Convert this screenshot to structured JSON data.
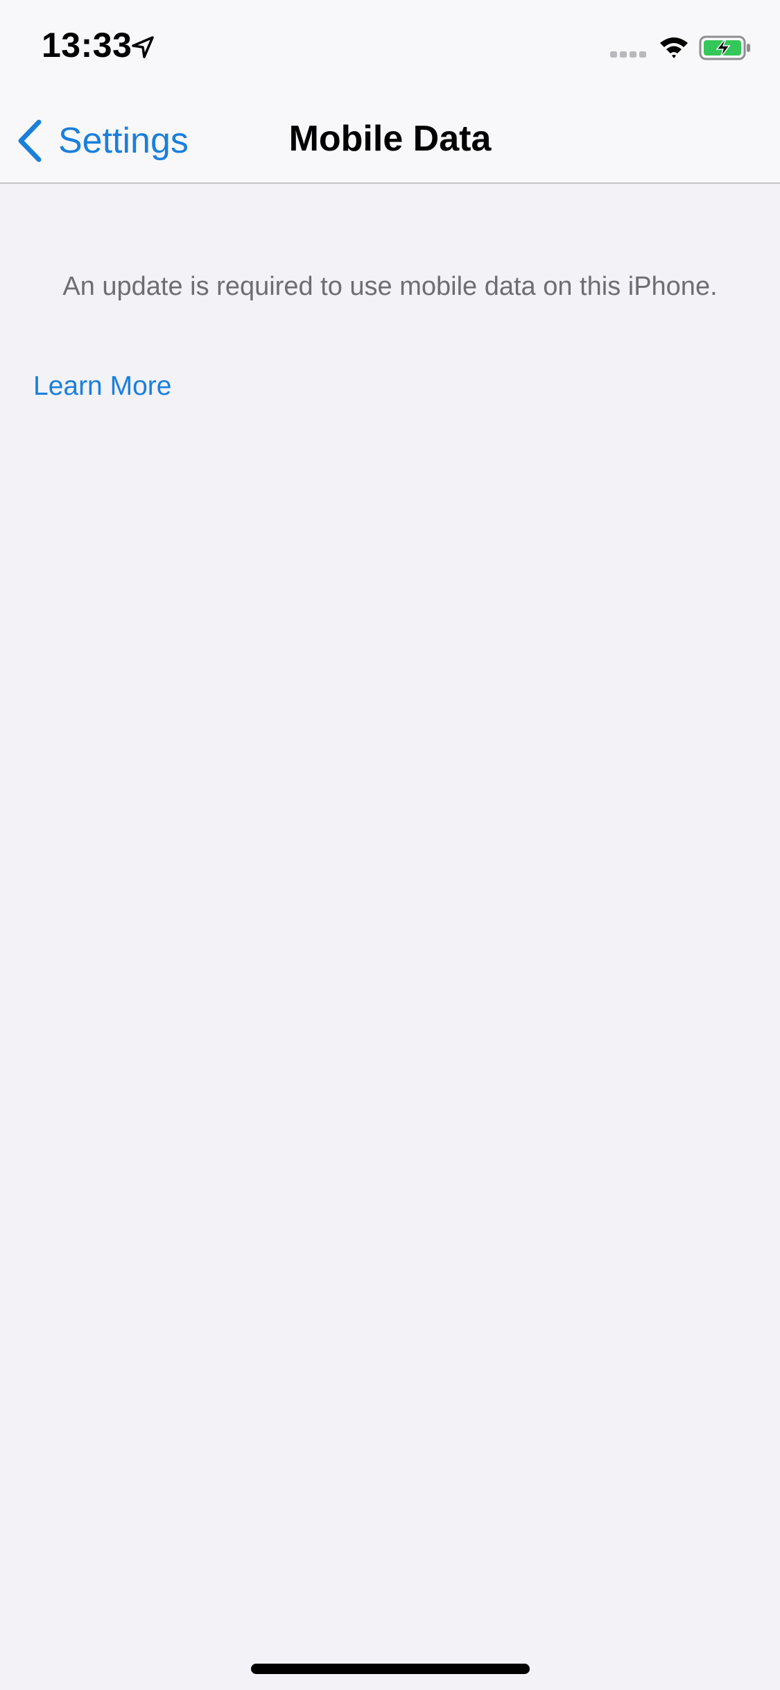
{
  "status_bar": {
    "time": "13:33",
    "icons": [
      "location-arrow-icon",
      "cellular-signal-icon",
      "wifi-icon",
      "battery-charging-icon"
    ],
    "battery_color": "#34c759"
  },
  "nav": {
    "back_label": "Settings",
    "title": "Mobile Data"
  },
  "content": {
    "message": "An update is required to use mobile data on this iPhone.",
    "learn_more": "Learn More"
  },
  "colors": {
    "accent": "#1a7fdb",
    "background": "#f2f2f7",
    "secondary_text": "#6d6d72"
  }
}
